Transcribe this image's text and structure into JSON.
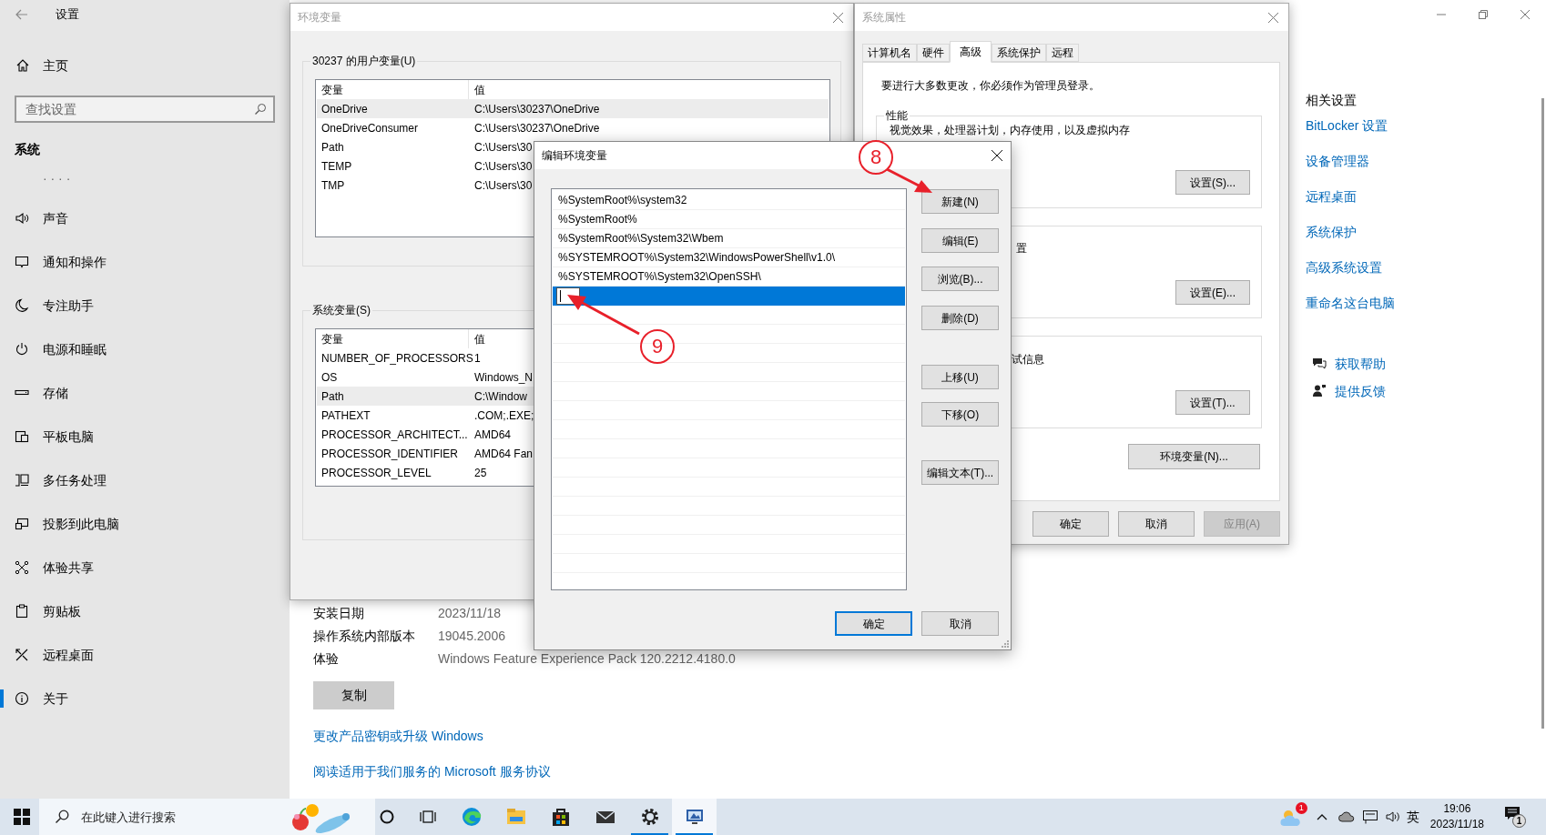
{
  "settings": {
    "title": "设置",
    "home": "主页",
    "search_placeholder": "查找设置",
    "section": "系统",
    "nav": [
      {
        "label": "· · · ·",
        "selected": false
      },
      {
        "label": "声音",
        "selected": false
      },
      {
        "label": "通知和操作",
        "selected": false
      },
      {
        "label": "专注助手",
        "selected": false
      },
      {
        "label": "电源和睡眠",
        "selected": false
      },
      {
        "label": "存储",
        "selected": false
      },
      {
        "label": "平板电脑",
        "selected": false
      },
      {
        "label": "多任务处理",
        "selected": false
      },
      {
        "label": "投影到此电脑",
        "selected": false
      },
      {
        "label": "体验共享",
        "selected": false
      },
      {
        "label": "剪贴板",
        "selected": false
      },
      {
        "label": "远程桌面",
        "selected": false
      },
      {
        "label": "关于",
        "selected": true
      }
    ],
    "about": [
      {
        "label": "安装日期",
        "value": "2023/11/18"
      },
      {
        "label": "操作系统内部版本",
        "value": "19045.2006"
      },
      {
        "label": "体验",
        "value": "Windows Feature Experience Pack 120.2212.4180.0"
      }
    ],
    "copy_button": "复制",
    "links": [
      "更改产品密钥或升级 Windows",
      "阅读适用于我们服务的 Microsoft 服务协议"
    ],
    "related_title": "相关设置",
    "related_links": [
      "BitLocker 设置",
      "设备管理器",
      "远程桌面",
      "系统保护",
      "高级系统设置",
      "重命名这台电脑"
    ],
    "help_links": [
      "获取帮助",
      "提供反馈"
    ]
  },
  "env_window": {
    "title": "环境变量",
    "user_group": {
      "title": "30237 的用户变量(U)",
      "columns": [
        "变量",
        "值"
      ],
      "rows": [
        {
          "name": "OneDrive",
          "value": "C:\\Users\\30237\\OneDrive",
          "selected": true
        },
        {
          "name": "OneDriveConsumer",
          "value": "C:\\Users\\30237\\OneDrive",
          "selected": false
        },
        {
          "name": "Path",
          "value": "C:\\Users\\30",
          "selected": false
        },
        {
          "name": "TEMP",
          "value": "C:\\Users\\30",
          "selected": false
        },
        {
          "name": "TMP",
          "value": "C:\\Users\\30",
          "selected": false
        }
      ]
    },
    "system_group": {
      "title": "系统变量(S)",
      "columns": [
        "变量",
        "值"
      ],
      "rows": [
        {
          "name": "NUMBER_OF_PROCESSORS",
          "value": "1",
          "selected": false
        },
        {
          "name": "OS",
          "value": "Windows_N",
          "selected": false
        },
        {
          "name": "Path",
          "value": "C:\\Window",
          "selected": true
        },
        {
          "name": "PATHEXT",
          "value": ".COM;.EXE;",
          "selected": false
        },
        {
          "name": "PROCESSOR_ARCHITECT...",
          "value": "AMD64",
          "selected": false
        },
        {
          "name": "PROCESSOR_IDENTIFIER",
          "value": "AMD64 Fan",
          "selected": false
        },
        {
          "name": "PROCESSOR_LEVEL",
          "value": "25",
          "selected": false
        }
      ]
    }
  },
  "sysprops": {
    "title": "系统属性",
    "tabs": [
      {
        "label": "计算机名",
        "selected": false
      },
      {
        "label": "硬件",
        "selected": false
      },
      {
        "label": "高级",
        "selected": true
      },
      {
        "label": "系统保护",
        "selected": false
      },
      {
        "label": "远程",
        "selected": false
      }
    ],
    "notice": "要进行大多数更改，你必须作为管理员登录。",
    "groups": [
      {
        "title": "性能",
        "description": "视觉效果，处理器计划，内存使用，以及虚拟内存",
        "button": "设置(S)..."
      },
      {
        "description": "置",
        "button": "设置(E)..."
      },
      {
        "description": "试信息",
        "button": "设置(T)..."
      }
    ],
    "env_button": "环境变量(N)...",
    "buttons": [
      {
        "label": "确定",
        "disabled": false
      },
      {
        "label": "取消",
        "disabled": false
      },
      {
        "label": "应用(A)",
        "disabled": true
      }
    ]
  },
  "edit_dialog": {
    "title": "编辑环境变量",
    "entries": [
      {
        "kind": "text",
        "text": "%SystemRoot%\\system32",
        "selected": false
      },
      {
        "kind": "text",
        "text": "%SystemRoot%",
        "selected": false
      },
      {
        "kind": "text",
        "text": "%SystemRoot%\\System32\\Wbem",
        "selected": false
      },
      {
        "kind": "text",
        "text": "%SYSTEMROOT%\\System32\\WindowsPowerShell\\v1.0\\",
        "selected": false
      },
      {
        "kind": "text",
        "text": "%SYSTEMROOT%\\System32\\OpenSSH\\",
        "selected": false
      },
      {
        "kind": "edit",
        "selected": true
      }
    ],
    "side_buttons": [
      "新建(N)",
      "编辑(E)",
      "浏览(B)...",
      "删除(D)",
      "上移(U)",
      "下移(O)",
      "编辑文本(T)..."
    ],
    "ok": "确定",
    "cancel": "取消"
  },
  "annotations": [
    {
      "label": "8"
    },
    {
      "label": "9"
    }
  ],
  "taskbar": {
    "search_placeholder": "在此键入进行搜索",
    "apps": [
      {
        "running": false,
        "active": false
      },
      {
        "running": false,
        "active": false
      },
      {
        "running": false,
        "active": false
      },
      {
        "running": false,
        "active": false
      },
      {
        "running": true,
        "active": false
      },
      {
        "running": true,
        "active": true
      }
    ],
    "weather_badge": "1",
    "ime": "英",
    "time": "19:06",
    "date": "2023/11/18",
    "notification_count": "1"
  }
}
